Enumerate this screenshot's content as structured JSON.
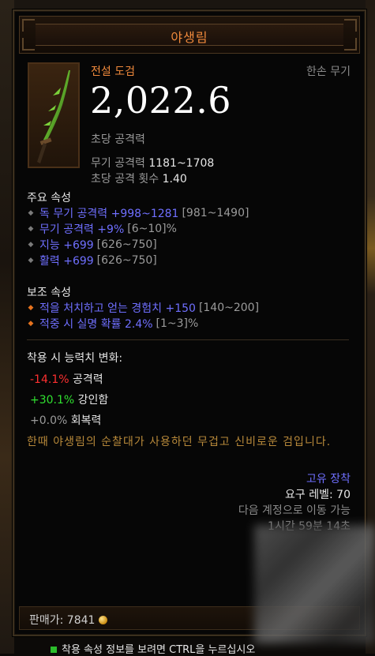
{
  "item": {
    "name": "야생림",
    "type": "전설 도검",
    "hand": "한손 무기",
    "dps": "2,022.6",
    "dps_label": "초당 공격력",
    "weapon_damage_label": "무기 공격력",
    "weapon_damage_value": "1181~1708",
    "attacks_per_second_label": "초당 공격 횟수",
    "attacks_per_second_value": "1.40"
  },
  "primary": {
    "heading": "주요 속성",
    "affixes": [
      {
        "text": "독 무기 공격력 +998~1281",
        "range": "[981~1490]"
      },
      {
        "text": "무기 공격력 +9%",
        "range": "[6~10]%"
      },
      {
        "text": "지능 +699",
        "range": "[626~750]"
      },
      {
        "text": "활력 +699",
        "range": "[626~750]"
      }
    ]
  },
  "secondary": {
    "heading": "보조 속성",
    "affixes": [
      {
        "text": "적을 처치하고 얻는 경험치 +150",
        "range": "[140~200]"
      },
      {
        "text": "적중 시 실명 확률 2.4%",
        "range": "[1~3]%"
      }
    ]
  },
  "changes": {
    "heading": "착용 시 능력치 변화:",
    "rows": [
      {
        "value": "-14.1%",
        "label": "공격력"
      },
      {
        "value": "+30.1%",
        "label": "강인함"
      },
      {
        "value": "+0.0%",
        "label": "회복력"
      }
    ]
  },
  "flavor": "한때 야생림의 순찰대가 사용하던 무겁고 신비로운 검입니다.",
  "footer": {
    "unique_equip": "고유 장착",
    "required_level": "요구 레벨: 70",
    "transfer": "다음 계정으로 이동 가능",
    "timer": "1시간 59분 14초"
  },
  "sell": {
    "label": "판매가: 7841"
  },
  "hint": "착용 속성 정보를 보려면 CTRL을 누르십시오",
  "colors": {
    "legendary": "#f08a3c",
    "magic": "#6f6fff",
    "negative": "#ff3030",
    "positive": "#30e030",
    "flavor": "#b8893a"
  }
}
